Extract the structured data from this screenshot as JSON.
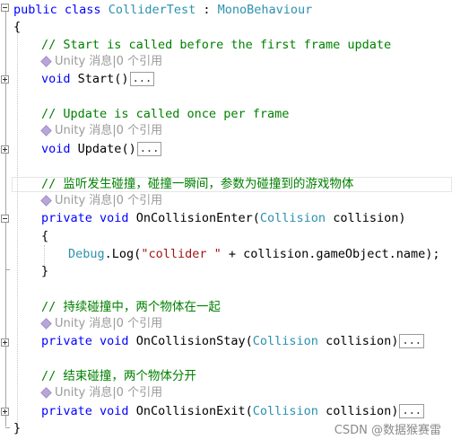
{
  "code": {
    "class_line": {
      "kw1": "public",
      "kw2": "class",
      "name": "ColliderTest",
      "sep": " : ",
      "base": "MonoBehaviour"
    },
    "open_brace": "{",
    "close_brace": "}",
    "start": {
      "comment": "// Start is called before the first frame update",
      "lens": "Unity 消息|0 个引用",
      "kw": "void",
      "name": "Start",
      "parens": "()",
      "collapsed": "..."
    },
    "update": {
      "comment": "// Update is called once per frame",
      "lens": "Unity 消息|0 个引用",
      "kw": "void",
      "name": "Update",
      "parens": "()",
      "collapsed": "..."
    },
    "enter": {
      "comment": "// 监听发生碰撞，碰撞一瞬间，参数为碰撞到的游戏物体",
      "lens": "Unity 消息|0 个引用",
      "kw1": "private",
      "kw2": "void",
      "name": "OnCollisionEnter",
      "param_type": "Collision",
      "param_name": "collision",
      "body_open": "{",
      "body_close": "}",
      "debug_class": "Debug",
      "debug_method": "Log",
      "debug_string": "\"collider \"",
      "debug_rest": " + collision.gameObject.name);"
    },
    "stay": {
      "comment": "// 持续碰撞中，两个物体在一起",
      "lens": "Unity 消息|0 个引用",
      "kw1": "private",
      "kw2": "void",
      "name": "OnCollisionStay",
      "param_type": "Collision",
      "param_name": "collision",
      "collapsed": "..."
    },
    "exit": {
      "comment": "// 结束碰撞，两个物体分开",
      "lens": "Unity 消息|0 个引用",
      "kw1": "private",
      "kw2": "void",
      "name": "OnCollisionExit",
      "param_type": "Collision",
      "param_name": "collision",
      "collapsed": "..."
    }
  },
  "watermark": "CSDN @数据猴赛雷",
  "colors": {
    "keyword": "#0000ff",
    "type": "#2b91af",
    "comment": "#008000",
    "string": "#a31515",
    "codelens": "#9a9a9a"
  }
}
